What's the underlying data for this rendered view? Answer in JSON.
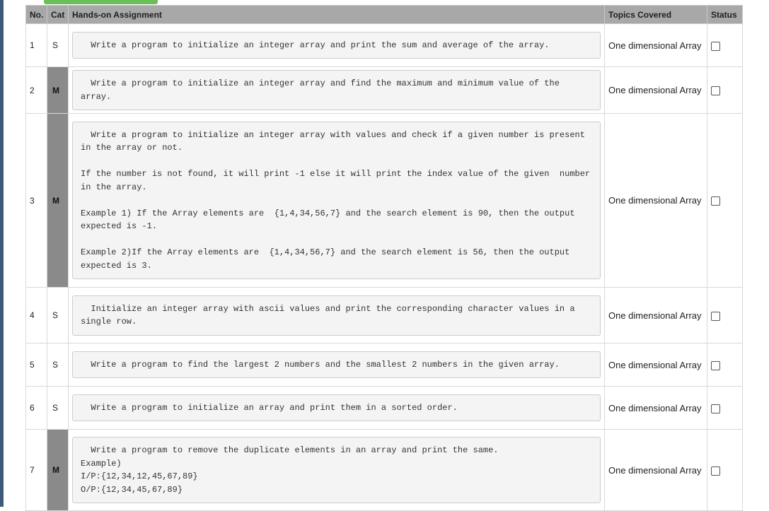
{
  "header": {
    "no": "No.",
    "cat": "Cat",
    "assignment": "Hands-on Assignment",
    "topics": "Topics Covered",
    "status": "Status"
  },
  "rows": [
    {
      "no": "1",
      "cat": "S",
      "text": "  Write a program to initialize an integer array and print the sum and average of the array.",
      "topic": "One dimensional Array"
    },
    {
      "no": "2",
      "cat": "M",
      "text": "  Write a program to initialize an integer array and find the maximum and minimum value of the array.",
      "topic": "One dimensional Array"
    },
    {
      "no": "3",
      "cat": "M",
      "text": "  Write a program to initialize an integer array with values and check if a given number is present in the array or not.\n\nIf the number is not found, it will print -1 else it will print the index value of the given  number in the array.\n\nExample 1) If the Array elements are  {1,4,34,56,7} and the search element is 90, then the output expected is -1.\n\nExample 2)If the Array elements are  {1,4,34,56,7} and the search element is 56, then the output expected is 3.",
      "topic": "One dimensional Array"
    },
    {
      "no": "4",
      "cat": "S",
      "text": "  Initialize an integer array with ascii values and print the corresponding character values in a single row.",
      "topic": "One dimensional Array"
    },
    {
      "no": "5",
      "cat": "S",
      "text": "  Write a program to find the largest 2 numbers and the smallest 2 numbers in the given array.",
      "topic": "One dimensional Array"
    },
    {
      "no": "6",
      "cat": "S",
      "text": "  Write a program to initialize an array and print them in a sorted order.",
      "topic": "One dimensional Array"
    },
    {
      "no": "7",
      "cat": "M",
      "text": "  Write a program to remove the duplicate elements in an array and print the same.\nExample)\nI/P:{12,34,12,45,67,89}\nO/P:{12,34,45,67,89}",
      "topic": "One dimensional Array"
    }
  ]
}
